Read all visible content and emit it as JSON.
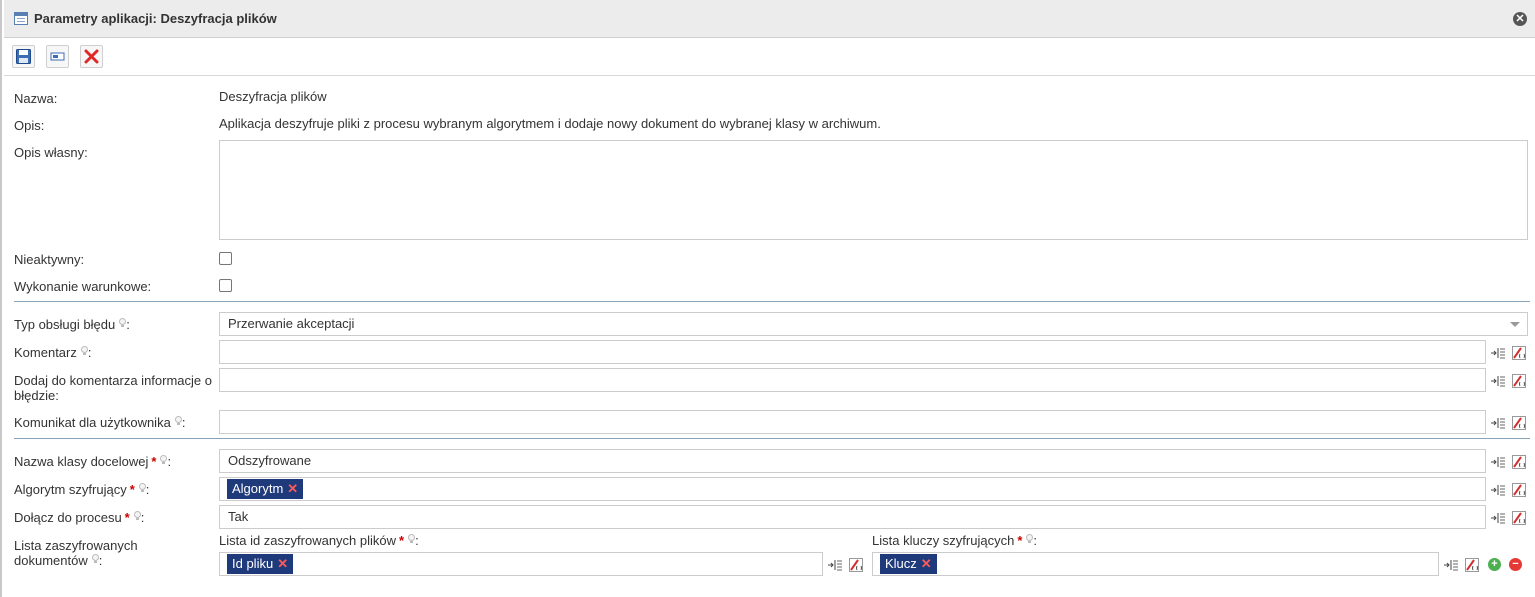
{
  "window": {
    "title": "Parametry aplikacji: Deszyfracja plików"
  },
  "form": {
    "nazwa_label": "Nazwa:",
    "nazwa_value": "Deszyfracja plików",
    "opis_label": "Opis:",
    "opis_value": "Aplikacja deszyfruje pliki z procesu wybranym algorytmem i dodaje nowy dokument do wybranej klasy w archiwum.",
    "opis_wlasny_label": "Opis własny:",
    "opis_wlasny_value": "",
    "nieaktywny_label": "Nieaktywny:",
    "nieaktywny_checked": false,
    "wykonanie_label": "Wykonanie warunkowe:",
    "wykonanie_checked": false
  },
  "error_section": {
    "typ_label": "Typ obsługi błędu",
    "typ_value": "Przerwanie akceptacji",
    "komentarz_label": "Komentarz",
    "komentarz_value": "",
    "dodaj_label_line1": "Dodaj do komentarza informacje o",
    "dodaj_label_line2": "błędzie:",
    "dodaj_value": "",
    "komunikat_label": "Komunikat dla użytkownika",
    "komunikat_value": ""
  },
  "params": {
    "klasa_label": "Nazwa klasy docelowej",
    "klasa_value": "Odszyfrowane",
    "algorytm_label": "Algorytm szyfrujący",
    "algorytm_tag": "Algorytm",
    "dolacz_label": "Dołącz do procesu",
    "dolacz_value": "Tak",
    "lista_label_line1": "Lista zaszyfrowanych",
    "lista_label_line2": "dokumentów",
    "lista_id_label": "Lista id zaszyfrowanych plików",
    "lista_id_tag": "Id pliku",
    "lista_kluczy_label": "Lista kluczy szyfrujących",
    "lista_kluczy_tag": "Klucz"
  },
  "symbols": {
    "required": "*",
    "colon": ":",
    "remove": "✕",
    "add": "+",
    "minus": "−"
  },
  "icons": [
    "table-icon",
    "close-window-icon",
    "save-icon",
    "field-icon",
    "delete-icon",
    "insert-variable-icon",
    "expression-icon",
    "hint-icon",
    "add-row-icon",
    "remove-row-icon"
  ],
  "colors": {
    "tag_bg": "#1f3a7a",
    "separator": "#8aa3bd",
    "required": "#cc0000",
    "add_green": "#4caf50",
    "remove_red": "#e53935"
  }
}
